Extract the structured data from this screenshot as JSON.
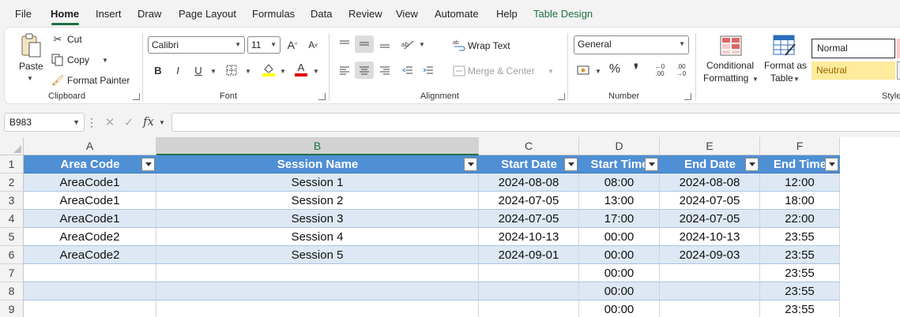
{
  "menu": [
    "File",
    "Home",
    "Insert",
    "Draw",
    "Page Layout",
    "Formulas",
    "Data",
    "Review",
    "View",
    "Automate",
    "Help",
    "Table Design"
  ],
  "ribbon": {
    "clipboard": {
      "paste": "Paste",
      "cut": "Cut",
      "copy": "Copy",
      "format_painter": "Format Painter",
      "label": "Clipboard"
    },
    "font": {
      "name": "Calibri",
      "size": "11",
      "label": "Font"
    },
    "alignment": {
      "wrap_text": "Wrap Text",
      "merge_center": "Merge & Center",
      "label": "Alignment"
    },
    "number": {
      "format": "General",
      "label": "Number"
    },
    "styles": {
      "conditional_formatting": [
        "Conditional",
        "Formatting"
      ],
      "format_as_table": [
        "Format as",
        "Table"
      ],
      "normal": "Normal",
      "neutral": "Neutral",
      "label": "Styles"
    }
  },
  "formula_bar": {
    "name_box": "B983",
    "fx": "fx",
    "formula": ""
  },
  "sheet": {
    "columns": [
      "A",
      "B",
      "C",
      "D",
      "E",
      "F"
    ],
    "selected_column": "B",
    "header_row": [
      "Area Code",
      "Session Name",
      "Start Date",
      "Start Time",
      "End Date",
      "End Time"
    ],
    "rows": [
      {
        "n": "1"
      },
      {
        "n": "2",
        "cells": [
          "AreaCode1",
          "Session 1",
          "2024-08-08",
          "08:00",
          "2024-08-08",
          "12:00"
        ]
      },
      {
        "n": "3",
        "cells": [
          "AreaCode1",
          "Session 2",
          "2024-07-05",
          "13:00",
          "2024-07-05",
          "18:00"
        ]
      },
      {
        "n": "4",
        "cells": [
          "AreaCode1",
          "Session 3",
          "2024-07-05",
          "17:00",
          "2024-07-05",
          "22:00"
        ]
      },
      {
        "n": "5",
        "cells": [
          "AreaCode2",
          "Session 4",
          "2024-10-13",
          "00:00",
          "2024-10-13",
          "23:55"
        ]
      },
      {
        "n": "6",
        "cells": [
          "AreaCode2",
          "Session 5",
          "2024-09-01",
          "00:00",
          "2024-09-03",
          "23:55"
        ]
      },
      {
        "n": "7",
        "cells": [
          "",
          "",
          "",
          "00:00",
          "",
          "23:55"
        ]
      },
      {
        "n": "8",
        "cells": [
          "",
          "",
          "",
          "00:00",
          "",
          "23:55"
        ]
      },
      {
        "n": "9",
        "cells": [
          "",
          "",
          "",
          "00:00",
          "",
          "23:55"
        ]
      }
    ]
  },
  "colors": {
    "accent": "#1e7145",
    "table_header": "#4f8fd4",
    "table_band": "#dde8f4",
    "neutral_fill": "#ffeb9c",
    "neutral_text": "#9c6500"
  }
}
